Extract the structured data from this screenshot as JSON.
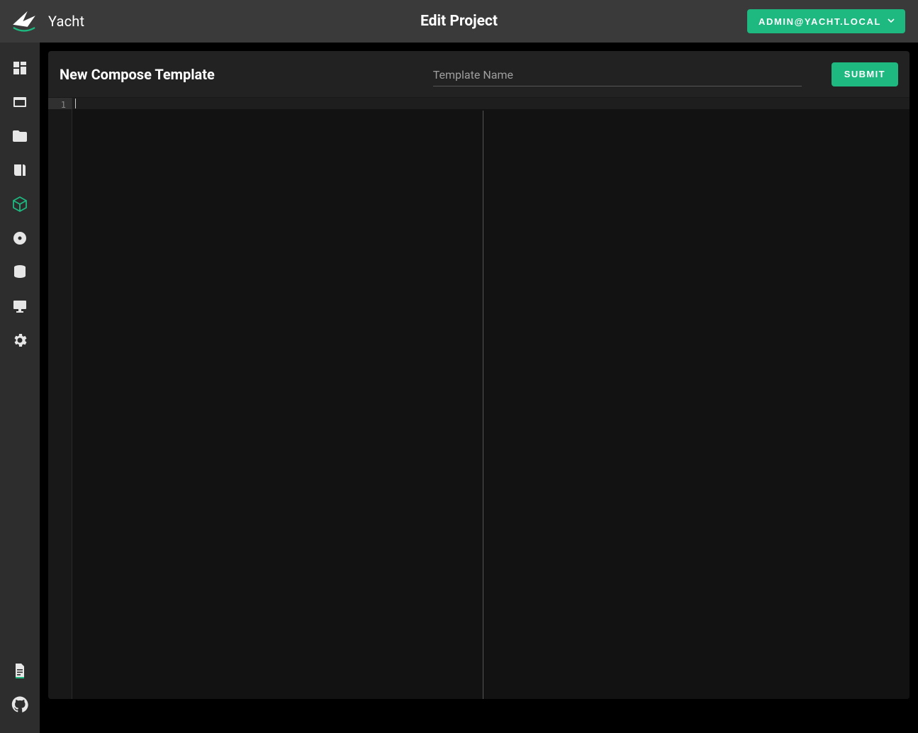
{
  "header": {
    "app_name": "Yacht",
    "page_title": "Edit Project",
    "user_label": "ADMIN@YACHT.LOCAL"
  },
  "sidebar": {
    "items": [
      {
        "name": "dashboard",
        "icon": "dashboard-icon",
        "active": false
      },
      {
        "name": "applications",
        "icon": "window-icon",
        "active": false
      },
      {
        "name": "templates",
        "icon": "folder-icon",
        "active": false
      },
      {
        "name": "resources",
        "icon": "book-icon",
        "active": false
      },
      {
        "name": "projects",
        "icon": "cube-icon",
        "active": true
      },
      {
        "name": "images",
        "icon": "disc-icon",
        "active": false
      },
      {
        "name": "volumes",
        "icon": "database-icon",
        "active": false
      },
      {
        "name": "networks",
        "icon": "monitor-icon",
        "active": false
      },
      {
        "name": "settings",
        "icon": "gear-icon",
        "active": false
      }
    ],
    "bottom_items": [
      {
        "name": "docs",
        "icon": "document-icon"
      },
      {
        "name": "github",
        "icon": "github-icon"
      }
    ]
  },
  "form": {
    "title": "New Compose Template",
    "name_placeholder": "Template Name",
    "name_value": "",
    "submit_label": "SUBMIT"
  },
  "editor": {
    "line_numbers": [
      "1"
    ],
    "content": ""
  },
  "colors": {
    "accent": "#1db980",
    "background": "#1e1e1e"
  }
}
